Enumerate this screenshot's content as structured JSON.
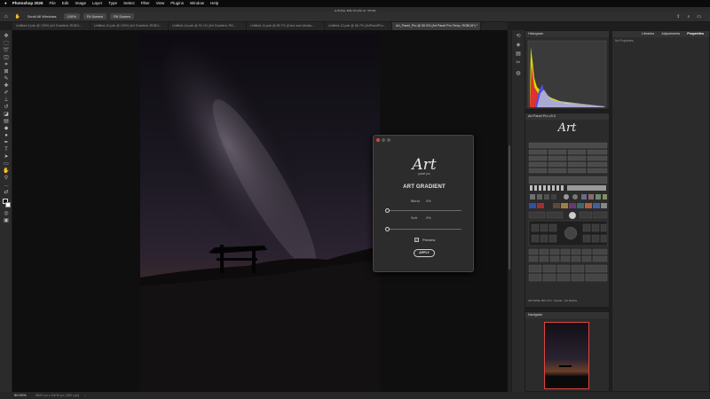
{
  "menubar": {
    "app": "Photoshop 2026",
    "items": [
      "File",
      "Edit",
      "Image",
      "Layer",
      "Type",
      "Select",
      "Filter",
      "View",
      "Plugins",
      "Window",
      "Help"
    ]
  },
  "window": {
    "title": "Adobe Photoshop 2026"
  },
  "options": {
    "scroll_all": "Scroll All Windows",
    "zoom": "100%",
    "fit_screen": "Fit Screen",
    "fill_screen": "Fill Screen"
  },
  "doc_tabs": [
    {
      "label": "Untitled-9.psb @ 100% (Art Gradient, RGB/1...",
      "active": false
    },
    {
      "label": "Untitled-10.psb @ 100% (Art Gradient, RGB/1...",
      "active": false
    },
    {
      "label": "Untitled-14.psb @ 91.1% (Art Gradient, RG...",
      "active": false
    },
    {
      "label": "Untitled-11.psb @ 66.7% (Color and vibrato...",
      "active": false
    },
    {
      "label": "Untitled-12.psb @ 66.7% (ArtPanelPro...",
      "active": false
    },
    {
      "label": "Art_Panel_Pro @ 50.0% (Art Panel Pro Temp, RGB/16*) *",
      "active": true
    }
  ],
  "status": {
    "zoom": "50.00%",
    "doc_info": "3600 px x 5400 px (300 ppi)"
  },
  "dialog": {
    "logo_text": "Art",
    "logo_sub": "panel pro",
    "heading": "ART GRADIENT",
    "blend_label": "Blend",
    "blend_value": "0%",
    "blend_level": 0,
    "soft_label": "Soft",
    "soft_value": "0%",
    "soft_level": 0,
    "preview_label": "Preview",
    "preview_checked": true,
    "apply_label": "APPLY"
  },
  "panels": {
    "histogram": {
      "title": "Histogram"
    },
    "plugin": {
      "title": "Art Panel Pro v3.0",
      "logo_text": "Art",
      "footer": "ART PANEL PRO V3.0 · Tutorials · Info Website"
    },
    "navigator": {
      "title": "Navigator",
      "zoom": "50.00%"
    },
    "right_tabs": [
      "Libraries",
      "Adjustments",
      "Properties"
    ],
    "properties_sub": "No Properties"
  },
  "colors": {
    "accent_red": "#e0443e",
    "bg": "#1e1e1e",
    "panel": "#2b2b2b"
  },
  "icons": [
    "move-icon",
    "marquee-icon",
    "lasso-icon",
    "crop-icon",
    "brush-icon",
    "eraser-icon",
    "gradient-icon",
    "text-icon",
    "hand-icon",
    "zoom-icon"
  ]
}
